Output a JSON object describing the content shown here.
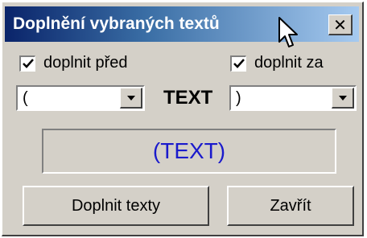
{
  "window": {
    "title": "Doplnění vybraných textů",
    "close_label": "×"
  },
  "options": {
    "before": {
      "label": "doplnit před",
      "checked": true
    },
    "after": {
      "label": "doplnit za",
      "checked": true
    }
  },
  "combos": {
    "before_value": "(",
    "after_value": ")"
  },
  "center_label": "TEXT",
  "preview_text": "(TEXT)",
  "buttons": {
    "apply_label": "Doplnit texty",
    "close_label": "Zavřít"
  },
  "colors": {
    "title_gradient_start": "#0a246a",
    "title_gradient_end": "#a6caf0",
    "preview_text": "#1a1acc",
    "face": "#d4d0c8"
  },
  "icons": {
    "check": "check-icon",
    "dropdown": "chevron-down-icon",
    "cursor": "mouse-pointer-icon"
  }
}
